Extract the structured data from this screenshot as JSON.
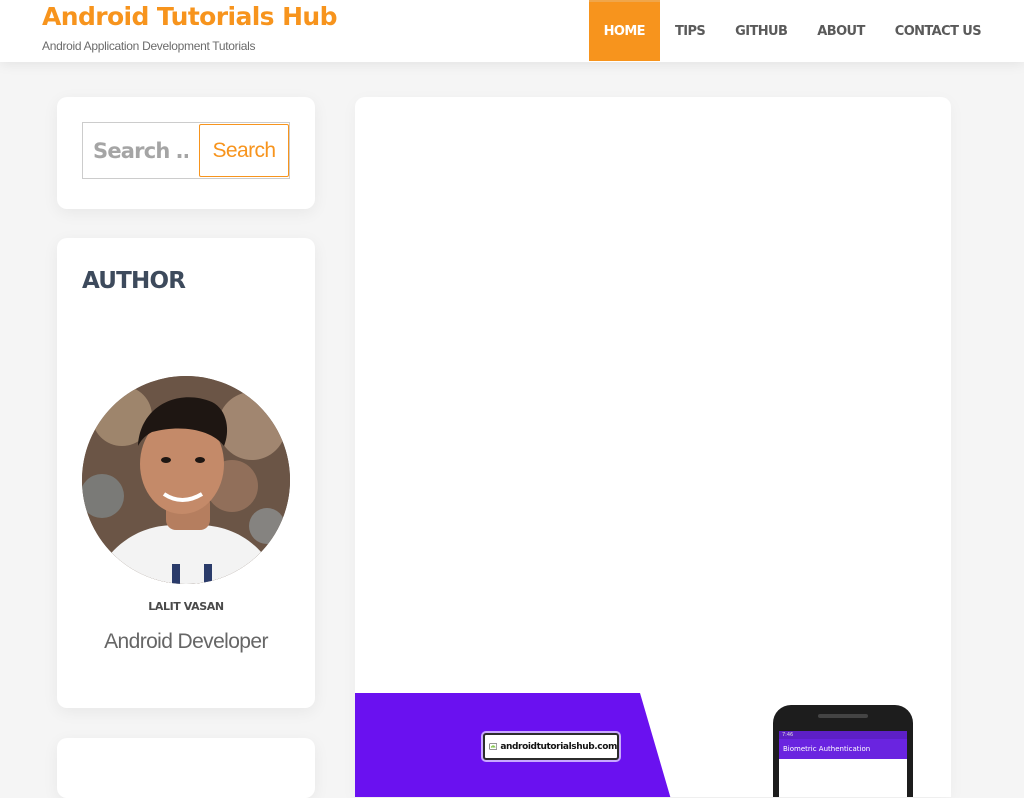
{
  "site": {
    "title": "Android Tutorials Hub",
    "tagline": "Android Application Development Tutorials"
  },
  "nav": {
    "items": [
      {
        "label": "HOME",
        "active": true
      },
      {
        "label": "TIPS",
        "active": false
      },
      {
        "label": "GITHUB",
        "active": false
      },
      {
        "label": "ABOUT",
        "active": false
      },
      {
        "label": "CONTACT US",
        "active": false
      }
    ]
  },
  "search": {
    "placeholder": "Search …",
    "value": "",
    "button_label": "Search"
  },
  "author": {
    "heading": "AUTHOR",
    "name": "LALIT VASAN",
    "role": "Android Developer",
    "avatar_icon": "author-photo"
  },
  "banner": {
    "logo_text": "androidtutorialshub.com",
    "phone_app_title": "Biometric Authentication",
    "phone_status_time": "7:46"
  },
  "colors": {
    "accent": "#f7941d",
    "header_bg": "#ffffff",
    "page_bg": "#f5f5f5",
    "banner_purple": "#6a11f0",
    "heading_text": "#3d4a5c"
  }
}
